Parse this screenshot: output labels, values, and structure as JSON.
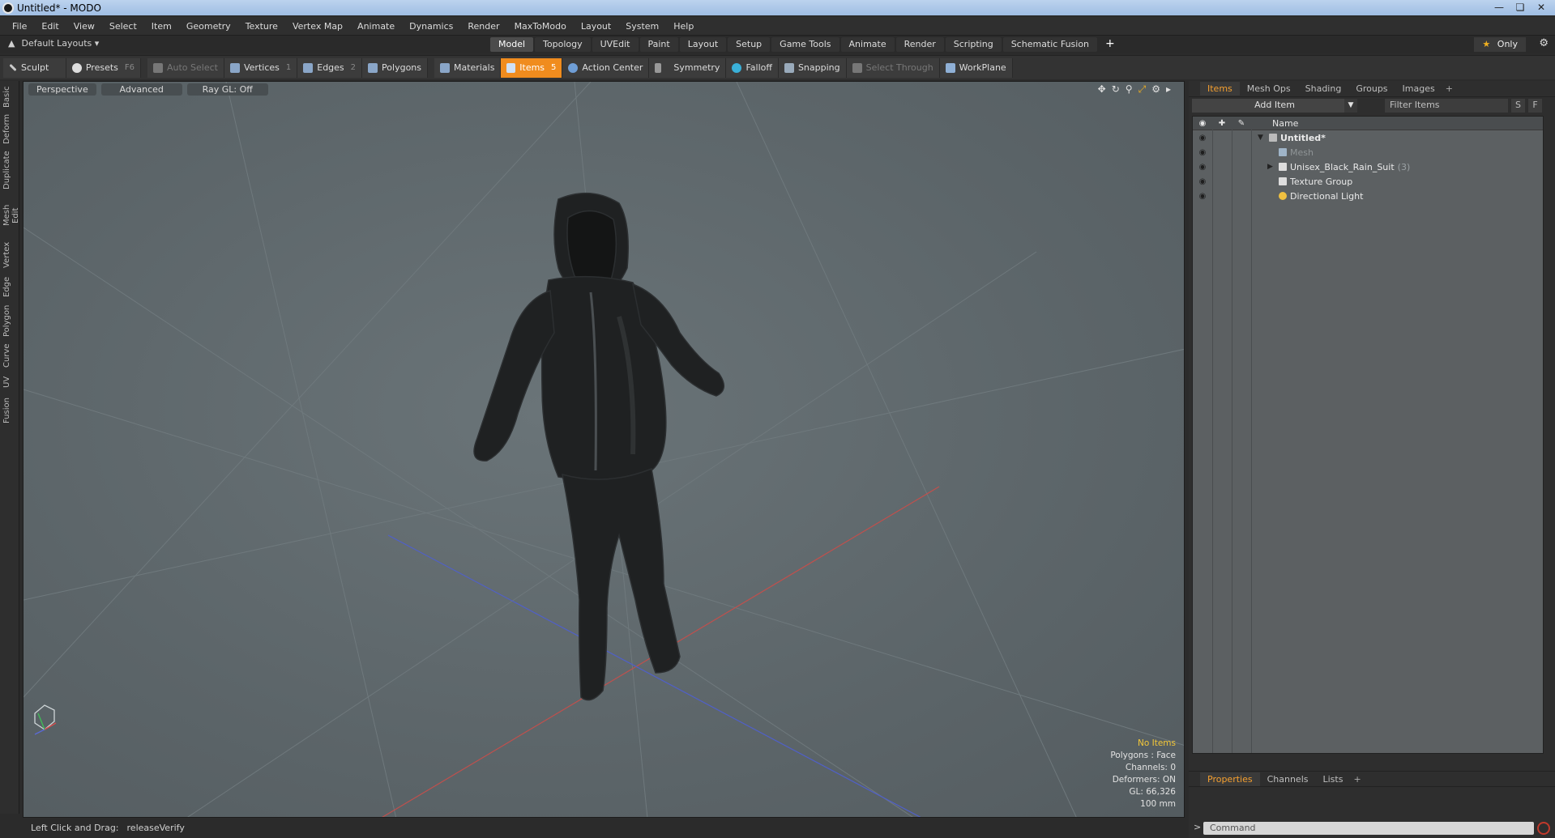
{
  "window": {
    "title": "Untitled* - MODO"
  },
  "menu": [
    "File",
    "Edit",
    "View",
    "Select",
    "Item",
    "Geometry",
    "Texture",
    "Vertex Map",
    "Animate",
    "Dynamics",
    "Render",
    "MaxToModo",
    "Layout",
    "System",
    "Help"
  ],
  "layout_row": {
    "layouts_label": "Default Layouts ▾",
    "tabs": [
      "Model",
      "Topology",
      "UVEdit",
      "Paint",
      "Layout",
      "Setup",
      "Game Tools",
      "Animate",
      "Render",
      "Scripting",
      "Schematic Fusion"
    ],
    "active_tab": "Model",
    "only_label": "Only"
  },
  "toolbar": {
    "sculpt": "Sculpt",
    "presets": "Presets",
    "presets_key": "F6",
    "auto_select": "Auto Select",
    "vertices": "Vertices",
    "vertices_key": "1",
    "edges": "Edges",
    "edges_key": "2",
    "polygons": "Polygons",
    "materials": "Materials",
    "items": "Items",
    "items_key": "5",
    "action_center": "Action Center",
    "symmetry": "Symmetry",
    "falloff": "Falloff",
    "snapping": "Snapping",
    "select_through": "Select Through",
    "workplane": "WorkPlane"
  },
  "left_tabs": [
    "Basic",
    "Deform",
    "Duplicate",
    "Mesh Edit",
    "Vertex",
    "Edge",
    "Polygon",
    "Curve",
    "UV",
    "Fusion"
  ],
  "viewport": {
    "view": "Perspective",
    "mode": "Advanced",
    "raygl": "Ray GL: Off",
    "stats": {
      "no_items": "No Items",
      "polygons": "Polygons : Face",
      "channels": "Channels: 0",
      "deformers": "Deformers: ON",
      "gl": "GL: 66,326",
      "scale": "100 mm"
    }
  },
  "status": {
    "left": "Left Click and Drag:",
    "right": "releaseVerify"
  },
  "right_panel": {
    "tabs": [
      "Items",
      "Mesh Ops",
      "Shading",
      "Groups",
      "Images"
    ],
    "add_item": "Add Item",
    "filter": "Filter Items",
    "s_btn": "S",
    "f_btn": "F",
    "name_header": "Name",
    "tree": [
      {
        "label": "Untitled*",
        "count": ""
      },
      {
        "label": "Mesh",
        "count": ""
      },
      {
        "label": "Unisex_Black_Rain_Suit",
        "count": "(3)"
      },
      {
        "label": "Texture Group",
        "count": ""
      },
      {
        "label": "Directional Light",
        "count": ""
      }
    ],
    "prop_tabs": [
      "Properties",
      "Channels",
      "Lists"
    ],
    "command_placeholder": "Command"
  },
  "colors": {
    "accent": "#f08c1e",
    "viewport_bg": "#5e676b"
  }
}
